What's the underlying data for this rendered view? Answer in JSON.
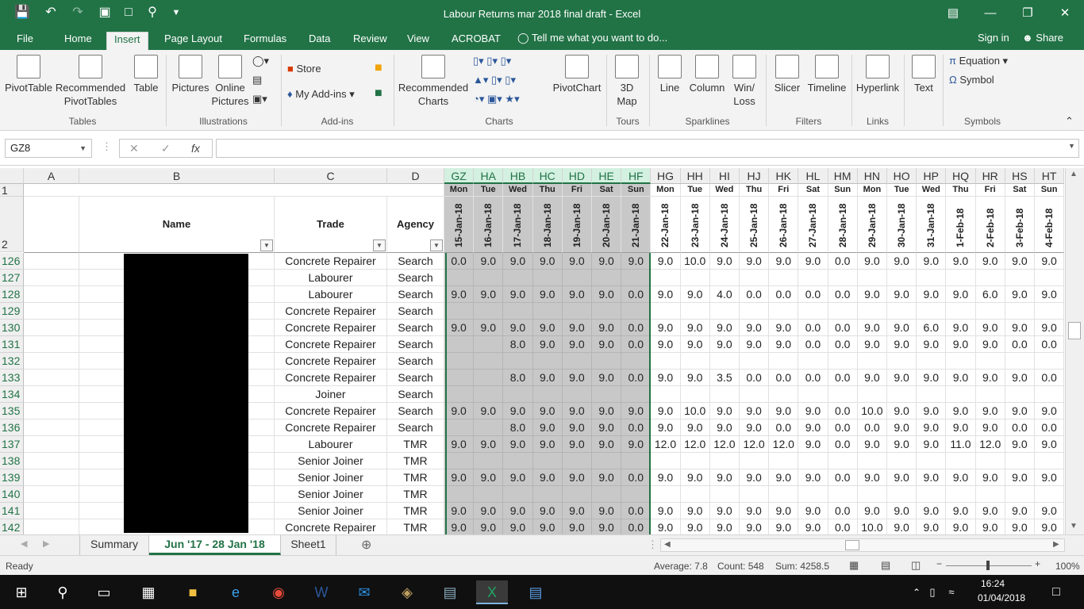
{
  "window": {
    "title": "Labour Returns mar 2018 final draft - Excel"
  },
  "ribbon_tabs": [
    "File",
    "Home",
    "Insert",
    "Page Layout",
    "Formulas",
    "Data",
    "Review",
    "View",
    "ACROBAT"
  ],
  "active_tab": "Insert",
  "tell_me": "Tell me what you want to do...",
  "sign_in": "Sign in",
  "share": "Share",
  "ribbon": {
    "pivottable": "PivotTable",
    "recommended_pivot_1": "Recommended",
    "recommended_pivot_2": "PivotTables",
    "table": "Table",
    "pictures": "Pictures",
    "online_pictures_1": "Online",
    "online_pictures_2": "Pictures",
    "store": "Store",
    "my_addins": "My Add-ins",
    "recommended_charts_1": "Recommended",
    "recommended_charts_2": "Charts",
    "pivotchart": "PivotChart",
    "map3d_1": "3D",
    "map3d_2": "Map",
    "line": "Line",
    "column": "Column",
    "winloss_1": "Win/",
    "winloss_2": "Loss",
    "slicer": "Slicer",
    "timeline": "Timeline",
    "hyperlink": "Hyperlink",
    "text": "Text",
    "equation": "Equation",
    "symbol": "Symbol",
    "groups": {
      "tables": "Tables",
      "illustrations": "Illustrations",
      "addins": "Add-ins",
      "charts": "Charts",
      "tours": "Tours",
      "sparklines": "Sparklines",
      "filters": "Filters",
      "links": "Links",
      "symbols": "Symbols"
    }
  },
  "name_box": "GZ8",
  "formula": "",
  "fx": "fx",
  "columns": {
    "fixed": [
      "A",
      "B",
      "C",
      "D"
    ],
    "dates": [
      "GZ",
      "HA",
      "HB",
      "HC",
      "HD",
      "HE",
      "HF",
      "HG",
      "HH",
      "HI",
      "HJ",
      "HK",
      "HL",
      "HM",
      "HN",
      "HO",
      "HP",
      "HQ",
      "HR",
      "HS",
      "HT"
    ]
  },
  "header": {
    "name": "Name",
    "trade": "Trade",
    "agency": "Agency"
  },
  "days": [
    "Mon",
    "Tue",
    "Wed",
    "Thu",
    "Fri",
    "Sat",
    "Sun",
    "Mon",
    "Tue",
    "Wed",
    "Thu",
    "Fri",
    "Sat",
    "Sun",
    "Mon",
    "Tue",
    "Wed",
    "Thu",
    "Fri",
    "Sat",
    "Sun"
  ],
  "dates": [
    "15-Jan-18",
    "16-Jan-18",
    "17-Jan-18",
    "18-Jan-18",
    "19-Jan-18",
    "20-Jan-18",
    "21-Jan-18",
    "22-Jan-18",
    "23-Jan-18",
    "24-Jan-18",
    "25-Jan-18",
    "26-Jan-18",
    "27-Jan-18",
    "28-Jan-18",
    "29-Jan-18",
    "30-Jan-18",
    "31-Jan-18",
    "1-Feb-18",
    "2-Feb-18",
    "3-Feb-18",
    "4-Feb-18"
  ],
  "rows": [
    {
      "num": "126",
      "trade": "Concrete Repairer",
      "agency": "Search",
      "v": [
        "0.0",
        "9.0",
        "9.0",
        "9.0",
        "9.0",
        "9.0",
        "9.0",
        "9.0",
        "10.0",
        "9.0",
        "9.0",
        "9.0",
        "9.0",
        "0.0",
        "9.0",
        "9.0",
        "9.0",
        "9.0",
        "9.0",
        "9.0",
        "9.0"
      ]
    },
    {
      "num": "127",
      "trade": "Labourer",
      "agency": "Search",
      "v": [
        "",
        "",
        "",
        "",
        "",
        "",
        "",
        "",
        "",
        "",
        "",
        "",
        "",
        "",
        "",
        "",
        "",
        "",
        "",
        "",
        ""
      ]
    },
    {
      "num": "128",
      "trade": "Labourer",
      "agency": "Search",
      "v": [
        "9.0",
        "9.0",
        "9.0",
        "9.0",
        "9.0",
        "9.0",
        "0.0",
        "9.0",
        "9.0",
        "4.0",
        "0.0",
        "0.0",
        "0.0",
        "0.0",
        "9.0",
        "9.0",
        "9.0",
        "9.0",
        "6.0",
        "9.0",
        "9.0"
      ]
    },
    {
      "num": "129",
      "trade": "Concrete Repairer",
      "agency": "Search",
      "v": [
        "",
        "",
        "",
        "",
        "",
        "",
        "",
        "",
        "",
        "",
        "",
        "",
        "",
        "",
        "",
        "",
        "",
        "",
        "",
        "",
        ""
      ]
    },
    {
      "num": "130",
      "trade": "Concrete Repairer",
      "agency": "Search",
      "v": [
        "9.0",
        "9.0",
        "9.0",
        "9.0",
        "9.0",
        "9.0",
        "0.0",
        "9.0",
        "9.0",
        "9.0",
        "9.0",
        "9.0",
        "0.0",
        "0.0",
        "9.0",
        "9.0",
        "6.0",
        "9.0",
        "9.0",
        "9.0",
        "9.0"
      ]
    },
    {
      "num": "131",
      "trade": "Concrete Repairer",
      "agency": "Search",
      "v": [
        "",
        "",
        "8.0",
        "9.0",
        "9.0",
        "9.0",
        "0.0",
        "9.0",
        "9.0",
        "9.0",
        "9.0",
        "9.0",
        "0.0",
        "0.0",
        "9.0",
        "9.0",
        "9.0",
        "9.0",
        "9.0",
        "0.0",
        "0.0"
      ]
    },
    {
      "num": "132",
      "trade": "Concrete Repairer",
      "agency": "Search",
      "v": [
        "",
        "",
        "",
        "",
        "",
        "",
        "",
        "",
        "",
        "",
        "",
        "",
        "",
        "",
        "",
        "",
        "",
        "",
        "",
        "",
        ""
      ]
    },
    {
      "num": "133",
      "trade": "Concrete Repairer",
      "agency": "Search",
      "v": [
        "",
        "",
        "8.0",
        "9.0",
        "9.0",
        "9.0",
        "0.0",
        "9.0",
        "9.0",
        "3.5",
        "0.0",
        "0.0",
        "0.0",
        "0.0",
        "9.0",
        "9.0",
        "9.0",
        "9.0",
        "9.0",
        "9.0",
        "0.0"
      ]
    },
    {
      "num": "134",
      "trade": "Joiner",
      "agency": "Search",
      "v": [
        "",
        "",
        "",
        "",
        "",
        "",
        "",
        "",
        "",
        "",
        "",
        "",
        "",
        "",
        "",
        "",
        "",
        "",
        "",
        "",
        ""
      ]
    },
    {
      "num": "135",
      "trade": "Concrete Repairer",
      "agency": "Search",
      "v": [
        "9.0",
        "9.0",
        "9.0",
        "9.0",
        "9.0",
        "9.0",
        "9.0",
        "9.0",
        "10.0",
        "9.0",
        "9.0",
        "9.0",
        "9.0",
        "0.0",
        "10.0",
        "9.0",
        "9.0",
        "9.0",
        "9.0",
        "9.0",
        "9.0"
      ]
    },
    {
      "num": "136",
      "trade": "Concrete Repairer",
      "agency": "Search",
      "v": [
        "",
        "",
        "8.0",
        "9.0",
        "9.0",
        "9.0",
        "0.0",
        "9.0",
        "9.0",
        "9.0",
        "9.0",
        "0.0",
        "9.0",
        "0.0",
        "0.0",
        "9.0",
        "9.0",
        "9.0",
        "9.0",
        "0.0",
        "0.0"
      ]
    },
    {
      "num": "137",
      "trade": "Labourer",
      "agency": "TMR",
      "v": [
        "9.0",
        "9.0",
        "9.0",
        "9.0",
        "9.0",
        "9.0",
        "9.0",
        "12.0",
        "12.0",
        "12.0",
        "12.0",
        "12.0",
        "9.0",
        "0.0",
        "9.0",
        "9.0",
        "9.0",
        "11.0",
        "12.0",
        "9.0",
        "9.0"
      ]
    },
    {
      "num": "138",
      "trade": "Senior Joiner",
      "agency": "TMR",
      "v": [
        "",
        "",
        "",
        "",
        "",
        "",
        "",
        "",
        "",
        "",
        "",
        "",
        "",
        "",
        "",
        "",
        "",
        "",
        "",
        "",
        ""
      ]
    },
    {
      "num": "139",
      "trade": "Senior Joiner",
      "agency": "TMR",
      "v": [
        "9.0",
        "9.0",
        "9.0",
        "9.0",
        "9.0",
        "9.0",
        "0.0",
        "9.0",
        "9.0",
        "9.0",
        "9.0",
        "9.0",
        "9.0",
        "0.0",
        "9.0",
        "9.0",
        "9.0",
        "9.0",
        "9.0",
        "9.0",
        "9.0"
      ]
    },
    {
      "num": "140",
      "trade": "Senior Joiner",
      "agency": "TMR",
      "v": [
        "",
        "",
        "",
        "",
        "",
        "",
        "",
        "",
        "",
        "",
        "",
        "",
        "",
        "",
        "",
        "",
        "",
        "",
        "",
        "",
        ""
      ]
    },
    {
      "num": "141",
      "trade": "Senior Joiner",
      "agency": "TMR",
      "v": [
        "9.0",
        "9.0",
        "9.0",
        "9.0",
        "9.0",
        "9.0",
        "0.0",
        "9.0",
        "9.0",
        "9.0",
        "9.0",
        "9.0",
        "9.0",
        "0.0",
        "9.0",
        "9.0",
        "9.0",
        "9.0",
        "9.0",
        "9.0",
        "9.0"
      ]
    },
    {
      "num": "142",
      "trade": "Concrete Repairer",
      "agency": "TMR",
      "v": [
        "9.0",
        "9.0",
        "9.0",
        "9.0",
        "9.0",
        "9.0",
        "0.0",
        "9.0",
        "9.0",
        "9.0",
        "9.0",
        "9.0",
        "9.0",
        "0.0",
        "10.0",
        "9.0",
        "9.0",
        "9.0",
        "9.0",
        "9.0",
        "9.0"
      ]
    }
  ],
  "row_nums_top": [
    "1",
    "2"
  ],
  "sheets": [
    "Summary",
    "Jun '17 - 28 Jan '18",
    "Sheet1"
  ],
  "active_sheet": "Jun '17 - 28 Jan '18",
  "status": {
    "ready": "Ready",
    "average": "Average: 7.8",
    "count": "Count: 548",
    "sum": "Sum: 4258.5",
    "zoom": "100%"
  },
  "clock": {
    "time": "16:24",
    "date": "01/04/2018"
  },
  "colors": {
    "excel_green": "#217346",
    "selected_shade": "#c8c8c8"
  }
}
